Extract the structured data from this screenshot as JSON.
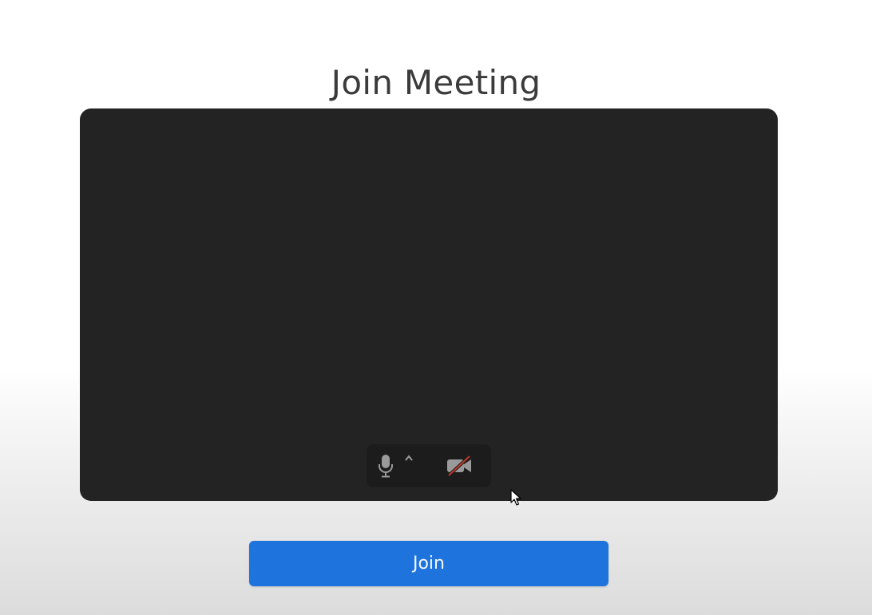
{
  "page": {
    "title": "Join Meeting"
  },
  "preview": {
    "controls": {
      "mic_icon": "microphone-icon",
      "audio_options_icon": "caret-up-icon",
      "video_icon": "video-off-icon"
    }
  },
  "join_button": {
    "label": "Join"
  },
  "colors": {
    "preview_background": "#232323",
    "controls_background": "#1c1c1c",
    "join_button": "#1e74dc",
    "icon": "#9a9a9a",
    "video_off_slash": "#c0392b",
    "title_text": "#3b3b3b"
  }
}
